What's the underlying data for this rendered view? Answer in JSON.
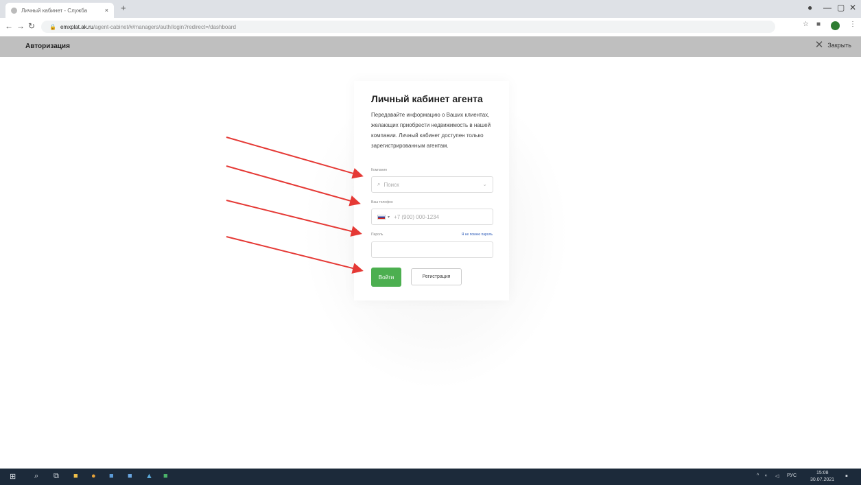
{
  "browser": {
    "tab_title": "Личный кабинет - Служба",
    "tab_close": "×",
    "new_tab": "+",
    "window_controls": [
      "—",
      "▢",
      "✕"
    ],
    "url_host": "emxplat.ak.ru",
    "url_path": "/agent-cabinet/#/managers/auth/login?redirect=/dashboard"
  },
  "app": {
    "header_title": "Авторизация",
    "exit_label": "Закрыть"
  },
  "card": {
    "title": "Личный кабинет агента",
    "description": "Передавайте информацию о Ваших клиентах, желающих приобрести недвижимость в нашей компании. Личный кабинет доступен только зарегистрированным агентам.",
    "company_label": "Компания",
    "company_placeholder": "Поиск",
    "phone_label": "Ваш телефон",
    "phone_placeholder": "+7 (900) 000-1234",
    "password_label": "Пароль",
    "forgot_label": "Я не помню пароль",
    "login_button": "Войти",
    "register_button": "Регистрация"
  },
  "taskbar": {
    "time": "15:08",
    "date": "30.07.2021",
    "lang": "РУС"
  },
  "colors": {
    "accent_green": "#4caf50",
    "arrow_red": "#e53935",
    "header_gray": "#bfbfbf",
    "taskbar": "#1c2a3a"
  }
}
